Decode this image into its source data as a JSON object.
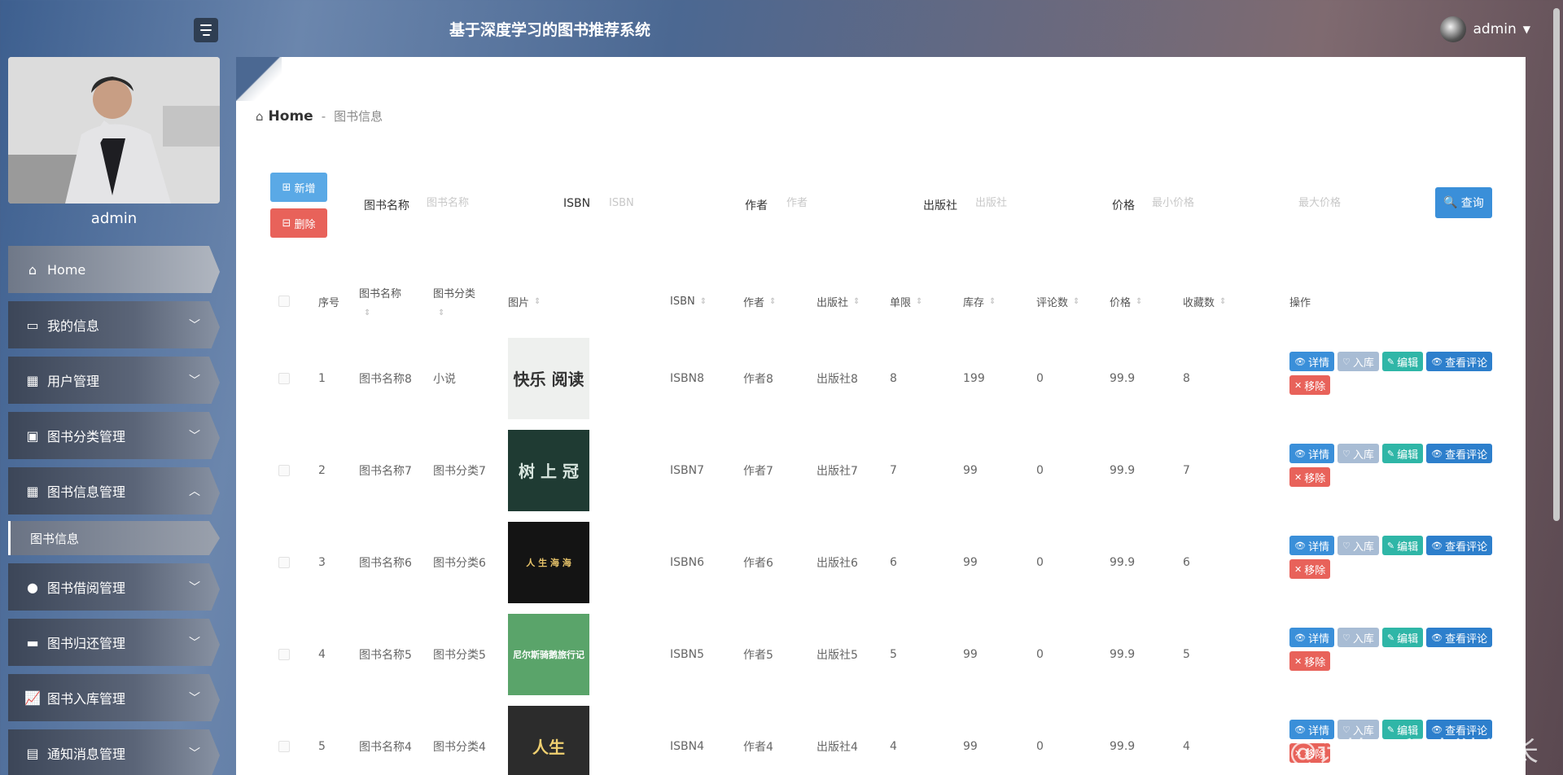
{
  "header": {
    "system_title": "基于深度学习的图书推荐系统",
    "user_name": "admin",
    "caret": "▼"
  },
  "sidebar": {
    "profile_name": "admin",
    "items": [
      {
        "label": "Home",
        "icon": "home-icon",
        "glyph": "⌂"
      },
      {
        "label": "我的信息",
        "icon": "id-card-icon",
        "glyph": "▭"
      },
      {
        "label": "用户管理",
        "icon": "grid-icon",
        "glyph": "▦"
      },
      {
        "label": "图书分类管理",
        "icon": "briefcase-icon",
        "glyph": "▣"
      },
      {
        "label": "图书信息管理",
        "icon": "grid-icon",
        "glyph": "▦"
      },
      {
        "label": "图书借阅管理",
        "icon": "user-icon",
        "glyph": "●"
      },
      {
        "label": "图书归还管理",
        "icon": "inbox-icon",
        "glyph": "▬"
      },
      {
        "label": "图书入库管理",
        "icon": "chart-icon",
        "glyph": "📈"
      },
      {
        "label": "通知消息管理",
        "icon": "clipboard-icon",
        "glyph": "▤"
      }
    ],
    "sub_item": "图书信息"
  },
  "breadcrumb": {
    "home": "Home",
    "separator": "-",
    "current": "图书信息"
  },
  "toolbar": {
    "add": "新增",
    "delete": "删除",
    "query": "查询"
  },
  "search": {
    "name_label": "图书名称",
    "name_placeholder": "图书名称",
    "isbn_label": "ISBN",
    "isbn_placeholder": "ISBN",
    "author_label": "作者",
    "author_placeholder": "作者",
    "publisher_label": "出版社",
    "publisher_placeholder": "出版社",
    "price_label": "价格",
    "price_min_placeholder": "最小价格",
    "price_max_placeholder": "最大价格"
  },
  "table": {
    "headers": {
      "index": "序号",
      "name": "图书名称",
      "category": "图书分类",
      "image": "图片",
      "isbn": "ISBN",
      "author": "作者",
      "publisher": "出版社",
      "limit": "单限",
      "stock": "库存",
      "reviews": "评论数",
      "price": "价格",
      "favorites": "收藏数",
      "actions": "操作"
    },
    "actions": {
      "detail": "详情",
      "stock_in": "入库",
      "edit": "编辑",
      "view_reviews": "查看评论",
      "remove": "移除"
    },
    "rows": [
      {
        "index": "1",
        "name": "图书名称8",
        "category": "小说",
        "cover_text": "快乐 阅读",
        "cover_bg": "#eef0ee",
        "cover_fg": "#333333",
        "isbn": "ISBN8",
        "author": "作者8",
        "publisher": "出版社8",
        "limit": "8",
        "stock": "199",
        "reviews": "0",
        "price": "99.9",
        "favorites": "8"
      },
      {
        "index": "2",
        "name": "图书名称7",
        "category": "图书分类7",
        "cover_text": "树 上 冠",
        "cover_bg": "#1f3b33",
        "cover_fg": "#d8e6df",
        "isbn": "ISBN7",
        "author": "作者7",
        "publisher": "出版社7",
        "limit": "7",
        "stock": "99",
        "reviews": "0",
        "price": "99.9",
        "favorites": "7"
      },
      {
        "index": "3",
        "name": "图书名称6",
        "category": "图书分类6",
        "cover_text": "人 生 海 海",
        "cover_bg": "#141414",
        "cover_fg": "#e8c46a",
        "isbn": "ISBN6",
        "author": "作者6",
        "publisher": "出版社6",
        "limit": "6",
        "stock": "99",
        "reviews": "0",
        "price": "99.9",
        "favorites": "6"
      },
      {
        "index": "4",
        "name": "图书名称5",
        "category": "图书分类5",
        "cover_text": "尼尔斯骑鹅旅行记",
        "cover_bg": "#5aa46a",
        "cover_fg": "#ffffff",
        "isbn": "ISBN5",
        "author": "作者5",
        "publisher": "出版社5",
        "limit": "5",
        "stock": "99",
        "reviews": "0",
        "price": "99.9",
        "favorites": "5"
      },
      {
        "index": "5",
        "name": "图书名称4",
        "category": "图书分类4",
        "cover_text": "人生",
        "cover_bg": "#2c2c2c",
        "cover_fg": "#f0d070",
        "isbn": "ISBN4",
        "author": "作者4",
        "publisher": "出版社4",
        "limit": "4",
        "stock": "99",
        "reviews": "0",
        "price": "99.9",
        "favorites": "4"
      }
    ]
  },
  "watermark": "CSDN @计算机程序猿学长",
  "colors": {
    "primary": "#3a8fd9",
    "danger": "#e8625a",
    "teal": "#2fb6a7",
    "muted": "#a8bcd4"
  }
}
